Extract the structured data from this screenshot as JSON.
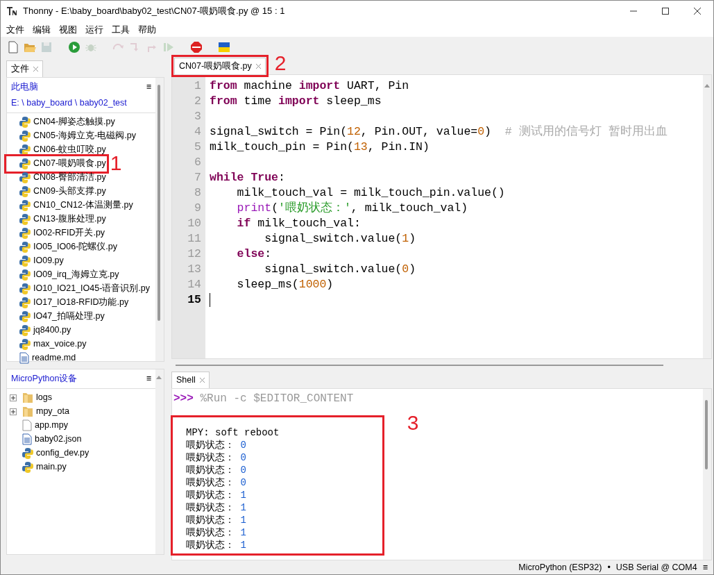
{
  "window": {
    "title": "Thonny  -  E:\\baby_board\\baby02_test\\CN07-喂奶喂食.py  @  15 : 1"
  },
  "menu": [
    "文件",
    "编辑",
    "视图",
    "运行",
    "工具",
    "帮助"
  ],
  "toolbar": [
    {
      "kind": "new",
      "disabled": false
    },
    {
      "kind": "open",
      "disabled": false
    },
    {
      "kind": "save",
      "disabled": true
    },
    {
      "kind": "run",
      "disabled": false
    },
    {
      "kind": "debug",
      "disabled": true
    },
    {
      "kind": "step-over",
      "disabled": true
    },
    {
      "kind": "step-into",
      "disabled": true
    },
    {
      "kind": "step-out",
      "disabled": true
    },
    {
      "kind": "resume",
      "disabled": true
    },
    {
      "kind": "stop",
      "disabled": false
    },
    {
      "kind": "flag",
      "disabled": false
    }
  ],
  "files_panel": {
    "tab": "文件",
    "heading": "此电脑",
    "menu": "≡",
    "path": "E: \\ baby_board \\ baby02_test",
    "items": [
      {
        "name": "CN04-脚姿态触摸.py",
        "kind": "python"
      },
      {
        "name": "CN05-海姆立克-电磁阀.py",
        "kind": "python"
      },
      {
        "name": "CN06-蚊虫叮咬.py",
        "kind": "python"
      },
      {
        "name": "CN07-喂奶喂食.py",
        "kind": "python",
        "annotation": "1"
      },
      {
        "name": "CN08-臀部清洁.py",
        "kind": "python"
      },
      {
        "name": "CN09-头部支撑.py",
        "kind": "python"
      },
      {
        "name": "CN10_CN12-体温测量.py",
        "kind": "python"
      },
      {
        "name": "CN13-腹胀处理.py",
        "kind": "python"
      },
      {
        "name": "IO02-RFID开关.py",
        "kind": "python"
      },
      {
        "name": "IO05_IO06-陀螺仪.py",
        "kind": "python"
      },
      {
        "name": "IO09.py",
        "kind": "python"
      },
      {
        "name": "IO09_irq_海姆立克.py",
        "kind": "python"
      },
      {
        "name": "IO10_IO21_IO45-语音识别.py",
        "kind": "python"
      },
      {
        "name": "IO17_IO18-RFID功能.py",
        "kind": "python"
      },
      {
        "name": "IO47_拍嗝处理.py",
        "kind": "python"
      },
      {
        "name": "jq8400.py",
        "kind": "python"
      },
      {
        "name": "max_voice.py",
        "kind": "python"
      },
      {
        "name": "readme.md",
        "kind": "text"
      }
    ]
  },
  "device_panel": {
    "heading": "MicroPython设备",
    "menu": "≡",
    "items": [
      {
        "name": "logs",
        "kind": "folder",
        "expanded": false
      },
      {
        "name": "mpy_ota",
        "kind": "folder",
        "expanded": false
      },
      {
        "name": "app.mpy",
        "kind": "blank"
      },
      {
        "name": "baby02.json",
        "kind": "text"
      },
      {
        "name": "config_dev.py",
        "kind": "python"
      },
      {
        "name": "main.py",
        "kind": "python"
      }
    ]
  },
  "editor": {
    "tab": "CN07-喂奶喂食.py",
    "annotation": "2",
    "lines": [
      {
        "number": "1",
        "current": false,
        "tokens": [
          {
            "text": "from",
            "kind": "kw"
          },
          {
            "text": " machine ",
            "kind": "plain"
          },
          {
            "text": "import",
            "kind": "kw"
          },
          {
            "text": " UART, Pin",
            "kind": "plain"
          }
        ]
      },
      {
        "number": "2",
        "current": false,
        "tokens": [
          {
            "text": "from",
            "kind": "kw"
          },
          {
            "text": " time ",
            "kind": "plain"
          },
          {
            "text": "import",
            "kind": "kw"
          },
          {
            "text": " sleep_ms",
            "kind": "plain"
          }
        ]
      },
      {
        "number": "3",
        "current": false
      },
      {
        "number": "4",
        "current": false,
        "tokens": [
          {
            "text": "signal_switch = Pin(",
            "kind": "plain"
          },
          {
            "text": "12",
            "kind": "num"
          },
          {
            "text": ", Pin.OUT, value=",
            "kind": "plain"
          },
          {
            "text": "0",
            "kind": "num"
          },
          {
            "text": ")  ",
            "kind": "plain"
          },
          {
            "text": "# 测试用的信号灯 暂时用出血",
            "kind": "comment"
          }
        ]
      },
      {
        "number": "5",
        "current": false,
        "tokens": [
          {
            "text": "milk_touch_pin = Pin(",
            "kind": "plain"
          },
          {
            "text": "13",
            "kind": "num"
          },
          {
            "text": ", Pin.IN)",
            "kind": "plain"
          }
        ]
      },
      {
        "number": "6",
        "current": false
      },
      {
        "number": "7",
        "current": false,
        "tokens": [
          {
            "text": "while",
            "kind": "kw"
          },
          {
            "text": " True",
            "kind": "kw"
          },
          {
            "text": ":",
            "kind": "plain"
          }
        ]
      },
      {
        "number": "8",
        "current": false,
        "tokens": [
          {
            "text": "    milk_touch_val = milk_touch_pin.value()",
            "kind": "plain"
          }
        ]
      },
      {
        "number": "9",
        "current": false,
        "tokens": [
          {
            "text": "    print",
            "kind": "builtin"
          },
          {
            "text": "(",
            "kind": "plain"
          },
          {
            "text": "'喂奶状态：'",
            "kind": "str"
          },
          {
            "text": ", milk_touch_val)",
            "kind": "plain"
          }
        ]
      },
      {
        "number": "10",
        "current": false,
        "tokens": [
          {
            "text": "    if",
            "kind": "kw"
          },
          {
            "text": " milk_touch_val:",
            "kind": "plain"
          }
        ]
      },
      {
        "number": "11",
        "current": false,
        "tokens": [
          {
            "text": "        signal_switch.value(",
            "kind": "plain"
          },
          {
            "text": "1",
            "kind": "num"
          },
          {
            "text": ")",
            "kind": "plain"
          }
        ]
      },
      {
        "number": "12",
        "current": false,
        "tokens": [
          {
            "text": "    else",
            "kind": "kw"
          },
          {
            "text": ":",
            "kind": "plain"
          }
        ]
      },
      {
        "number": "13",
        "current": false,
        "tokens": [
          {
            "text": "        signal_switch.value(",
            "kind": "plain"
          },
          {
            "text": "0",
            "kind": "num"
          },
          {
            "text": ")",
            "kind": "plain"
          }
        ]
      },
      {
        "number": "14",
        "current": false,
        "tokens": [
          {
            "text": "    sleep_ms(",
            "kind": "plain"
          },
          {
            "text": "1000",
            "kind": "num"
          },
          {
            "text": ")",
            "kind": "plain"
          }
        ]
      },
      {
        "number": "15",
        "current": true
      }
    ]
  },
  "shell": {
    "tab": "Shell",
    "prompt": ">>>",
    "command": "%Run -c $EDITOR_CONTENT",
    "annotation": "3",
    "output": [
      {
        "text": "MPY: soft reboot"
      },
      {
        "text": "喂奶状态： ",
        "value": "0"
      },
      {
        "text": "喂奶状态： ",
        "value": "0"
      },
      {
        "text": "喂奶状态： ",
        "value": "0"
      },
      {
        "text": "喂奶状态： ",
        "value": "0"
      },
      {
        "text": "喂奶状态： ",
        "value": "1"
      },
      {
        "text": "喂奶状态： ",
        "value": "1"
      },
      {
        "text": "喂奶状态： ",
        "value": "1"
      },
      {
        "text": "喂奶状态： ",
        "value": "1"
      },
      {
        "text": "喂奶状态： ",
        "value": "1"
      }
    ]
  },
  "status_bar": {
    "interpreter": "MicroPython (ESP32)",
    "separator": "•",
    "port": "USB Serial @ COM4",
    "menu": "≡"
  }
}
